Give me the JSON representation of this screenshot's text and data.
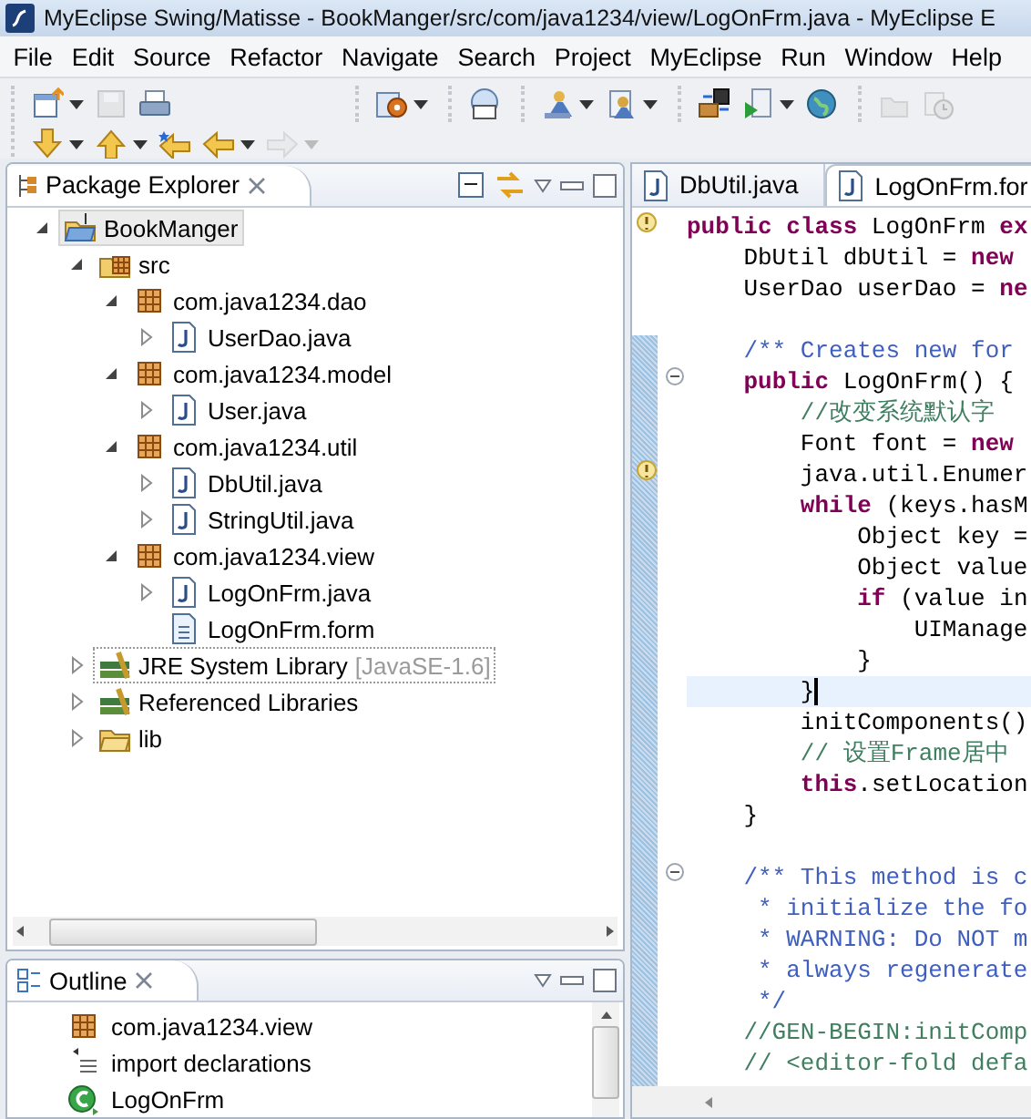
{
  "window": {
    "title": "MyEclipse Swing/Matisse - BookManger/src/com/java1234/view/LogOnFrm.java - MyEclipse E"
  },
  "menu": [
    "File",
    "Edit",
    "Source",
    "Refactor",
    "Navigate",
    "Search",
    "Project",
    "MyEclipse",
    "Run",
    "Window",
    "Help"
  ],
  "toolbar": {
    "rows": [
      {
        "groups": [
          {
            "buttons": [
              {
                "dropdown": true,
                "disabled": false
              },
              {
                "dropdown": false,
                "disabled": true
              },
              {
                "dropdown": false,
                "disabled": false
              }
            ]
          },
          {
            "buttons": [
              {
                "dropdown": true,
                "disabled": false
              }
            ]
          },
          {
            "buttons": [
              {
                "dropdown": false,
                "disabled": false
              }
            ]
          },
          {
            "buttons": [
              {
                "dropdown": true,
                "disabled": false
              },
              {
                "dropdown": true,
                "disabled": false
              }
            ]
          },
          {
            "buttons": [
              {
                "dropdown": false,
                "disabled": false
              },
              {
                "dropdown": true,
                "disabled": false
              },
              {
                "dropdown": false,
                "disabled": false
              }
            ]
          },
          {
            "buttons": [
              {
                "dropdown": false,
                "disabled": true
              },
              {
                "dropdown": false,
                "disabled": true
              }
            ]
          }
        ]
      },
      {
        "groups": [
          {
            "buttons": [
              {
                "dropdown": true,
                "disabled": false
              },
              {
                "dropdown": true,
                "disabled": false
              },
              {
                "dropdown": false,
                "disabled": false
              },
              {
                "dropdown": true,
                "disabled": false
              },
              {
                "dropdown": true,
                "disabled": true
              }
            ]
          }
        ]
      }
    ]
  },
  "package_explorer": {
    "title": "Package Explorer",
    "tree": [
      {
        "label": "BookManger",
        "kind": "project",
        "expanded": true,
        "selected": true,
        "focused": false,
        "children": [
          {
            "label": "src",
            "kind": "source_folder",
            "expanded": true,
            "selected": false,
            "focused": false,
            "children": [
              {
                "label": "com.java1234.dao",
                "kind": "package",
                "expanded": true,
                "selected": false,
                "focused": false,
                "children": [
                  {
                    "label": "UserDao.java",
                    "kind": "java",
                    "expanded": false,
                    "selected": false,
                    "focused": false
                  }
                ]
              },
              {
                "label": "com.java1234.model",
                "kind": "package",
                "expanded": true,
                "selected": false,
                "focused": false,
                "children": [
                  {
                    "label": "User.java",
                    "kind": "java",
                    "expanded": false,
                    "selected": false,
                    "focused": false
                  }
                ]
              },
              {
                "label": "com.java1234.util",
                "kind": "package",
                "expanded": true,
                "selected": false,
                "focused": false,
                "children": [
                  {
                    "label": "DbUtil.java",
                    "kind": "java",
                    "expanded": false,
                    "selected": false,
                    "focused": false
                  },
                  {
                    "label": "StringUtil.java",
                    "kind": "java",
                    "expanded": false,
                    "selected": false,
                    "focused": false
                  }
                ]
              },
              {
                "label": "com.java1234.view",
                "kind": "package",
                "expanded": true,
                "selected": false,
                "focused": false,
                "children": [
                  {
                    "label": "LogOnFrm.java",
                    "kind": "java",
                    "expanded": false,
                    "selected": false,
                    "focused": false
                  },
                  {
                    "label": "LogOnFrm.form",
                    "kind": "form",
                    "selected": false,
                    "focused": false
                  }
                ]
              }
            ]
          },
          {
            "label": "JRE System Library",
            "decoration": "[JavaSE-1.6]",
            "kind": "library",
            "expanded": false,
            "selected": false,
            "focused": true
          },
          {
            "label": "Referenced Libraries",
            "kind": "library",
            "expanded": false,
            "selected": false,
            "focused": false
          },
          {
            "label": "lib",
            "kind": "folder",
            "expanded": false,
            "selected": false,
            "focused": false
          }
        ]
      }
    ]
  },
  "outline": {
    "title": "Outline",
    "items": [
      {
        "label": "com.java1234.view",
        "kind": "package"
      },
      {
        "label": "import declarations",
        "kind": "imports"
      },
      {
        "label": "LogOnFrm",
        "kind": "class"
      }
    ]
  },
  "editor": {
    "tabs": [
      {
        "label": "DbUtil.java",
        "selected": false
      },
      {
        "label": "LogOnFrm.for",
        "selected": true
      }
    ],
    "lines": [
      {
        "kind": "code",
        "warning": true,
        "foldable": false,
        "current": false,
        "text": "**public class** LogOnFrm **ex**"
      },
      {
        "kind": "code",
        "warning": false,
        "foldable": false,
        "current": false,
        "text": "    DbUtil dbUtil = **new**"
      },
      {
        "kind": "code",
        "warning": false,
        "foldable": false,
        "current": false,
        "text": "    UserDao userDao = **ne**"
      },
      {
        "kind": "blank",
        "warning": false,
        "foldable": false,
        "current": false
      },
      {
        "kind": "javadoc",
        "warning": false,
        "foldable": false,
        "current": false,
        "text": "    /** Creates new for"
      },
      {
        "kind": "code",
        "warning": false,
        "foldable": true,
        "current": false,
        "text": "    **public** LogOnFrm() {"
      },
      {
        "kind": "comment",
        "warning": false,
        "foldable": false,
        "current": false,
        "text": "        //改变系统默认字"
      },
      {
        "kind": "code",
        "warning": false,
        "foldable": false,
        "current": false,
        "text": "        Font font = **new**"
      },
      {
        "kind": "code",
        "warning": true,
        "foldable": false,
        "current": false,
        "text": "        java.util.Enumer"
      },
      {
        "kind": "code",
        "warning": false,
        "foldable": false,
        "current": false,
        "text": "        **while** (keys.hasM"
      },
      {
        "kind": "code",
        "warning": false,
        "foldable": false,
        "current": false,
        "text": "            Object key ="
      },
      {
        "kind": "code",
        "warning": false,
        "foldable": false,
        "current": false,
        "text": "            Object value"
      },
      {
        "kind": "code",
        "warning": false,
        "foldable": false,
        "current": false,
        "text": "            **if** (value in"
      },
      {
        "kind": "code",
        "warning": false,
        "foldable": false,
        "current": false,
        "text": "                UIManage"
      },
      {
        "kind": "code",
        "warning": false,
        "foldable": false,
        "current": false,
        "text": "            }"
      },
      {
        "kind": "code",
        "warning": false,
        "foldable": false,
        "current": true,
        "text": "        }"
      },
      {
        "kind": "code",
        "warning": false,
        "foldable": false,
        "current": false,
        "text": "        initComponents()"
      },
      {
        "kind": "comment",
        "warning": false,
        "foldable": false,
        "current": false,
        "text": "        // 设置Frame居中"
      },
      {
        "kind": "code",
        "warning": false,
        "foldable": false,
        "current": false,
        "text": "        **this**.setLocation"
      },
      {
        "kind": "code",
        "warning": false,
        "foldable": false,
        "current": false,
        "text": "    }"
      },
      {
        "kind": "blank",
        "warning": false,
        "foldable": false,
        "current": false
      },
      {
        "kind": "javadoc",
        "warning": false,
        "foldable": true,
        "current": false,
        "text": "    /** This method is c"
      },
      {
        "kind": "javadoc",
        "warning": false,
        "foldable": false,
        "current": false,
        "text": "     * initialize the fo"
      },
      {
        "kind": "javadoc",
        "warning": false,
        "foldable": false,
        "current": false,
        "text": "     * WARNING: Do NOT m"
      },
      {
        "kind": "javadoc",
        "warning": false,
        "foldable": false,
        "current": false,
        "text": "     * always regenerate"
      },
      {
        "kind": "javadoc",
        "warning": false,
        "foldable": false,
        "current": false,
        "text": "     */"
      },
      {
        "kind": "comment",
        "warning": false,
        "foldable": false,
        "current": false,
        "text": "    //GEN-BEGIN:initComp"
      },
      {
        "kind": "comment",
        "warning": false,
        "foldable": false,
        "current": false,
        "text": "    // <editor-fold defa"
      }
    ]
  }
}
